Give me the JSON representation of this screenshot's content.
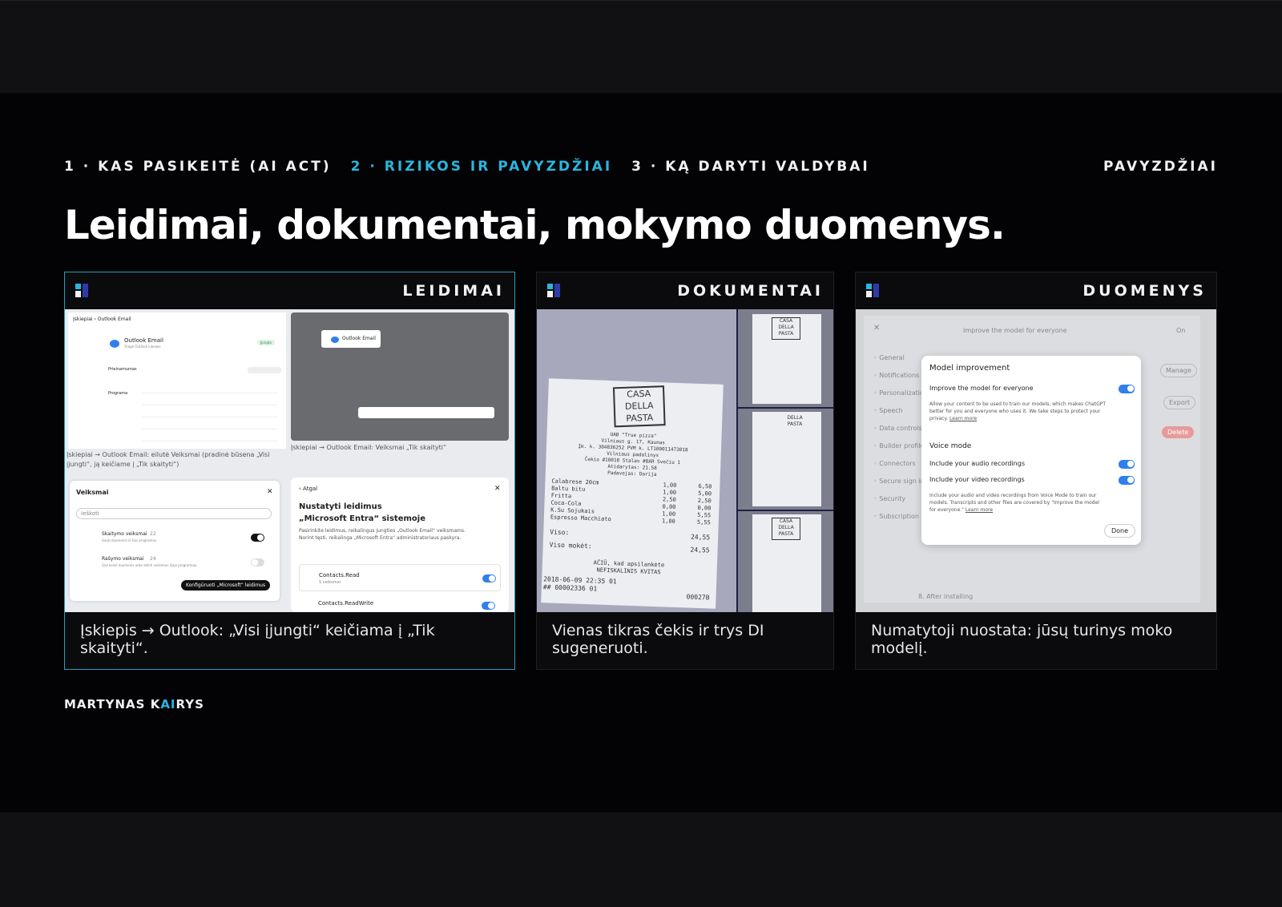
{
  "nav": {
    "items": [
      "1 · KAS PASIKEITĖ (AI ACT)",
      "2 · RIZIKOS IR PAVYZDŽIAI",
      "3 · KĄ DARYTI VALDYBAI"
    ],
    "right": "PAVYZDŽIAI"
  },
  "title": "Leidimai, dokumentai, mokymo duomenys.",
  "cards": [
    {
      "label": "LEIDIMAI",
      "caption": "Įskiepis → Outlook: „Visi įjungti“ keičiama į „Tik skaityti“.",
      "shot": {
        "breadcrumb": "Įskiepiai  ›  Outlook Email",
        "app_name": "Outlook Email",
        "app_sub": "Triage Outlook inboxes",
        "status": "Įjungta",
        "row1": "Prieinamumas",
        "row2": "Programa",
        "left_caption": "Įskiepiai → Outlook Email: eilutė Veiksmai (pradinė būsena „Visi įjungti“, ją keičiame į „Tik skaityti“)",
        "right_caption": "Įskiepiai → Outlook Email: Veiksmai „Tik skaityti“",
        "dialog_title": "Veiksmai",
        "search_placeholder": "Ieškoti",
        "read_actions": "Skaitymo veiksmai",
        "read_count": "22",
        "read_sub": "Gauti duomenis iš šios programos.",
        "write_actions": "Rašymo veiksmai",
        "write_count": "24",
        "write_sub": "Gali keisti duomenis arba atlikti veiksmus šioje programoje.",
        "configure_button": "Konfigūruoti „Microsoft“ leidimus",
        "back": "Atgal",
        "entra_title_1": "Nustatyti leidimus",
        "entra_title_2": "„Microsoft Entra“ sistemoje",
        "entra_desc": "Pasirinkite leidimus, reikalingus jungties „Outlook Email“ veiksmams. Norint tęsti, reikalinga „Microsoft Entra“ administratoriaus paskyra.",
        "perm1": "Contacts.Read",
        "perm1_sub": "5 veiksmai",
        "perm2": "Contacts.ReadWrite"
      }
    },
    {
      "label": "DOKUMENTAI",
      "caption": "Vienas tikras čekis ir trys DI sugeneruoti.",
      "shot": {
        "brand_1": "CASA",
        "brand_2": "DELLA",
        "brand_3": "PASTA",
        "lines": [
          "UAB \"True pizza\"",
          "Vilniaus g. 17, Kaunas",
          "Įm. k. 304836252  PVM k. LT100011473018",
          "Vilniaus padalinys",
          "Čekio #10018  Stalas #8AR  Svečiu 1",
          "Atidarytas: 21.58",
          "Padavejas: Darija"
        ],
        "items": [
          [
            "Calabrese 20cm",
            "1,00",
            "6,50"
          ],
          [
            "Baltu bitu",
            "1,00",
            "5,00"
          ],
          [
            "Fritta",
            "2,50",
            "2,50"
          ],
          [
            "Coca-Cola",
            "0,00",
            "0,00"
          ],
          [
            "K.Su Sojukais",
            "1,00",
            "5,55"
          ],
          [
            "Espresso Macchiato",
            "1,00",
            "5,55"
          ]
        ],
        "total_label_1": "Viso:",
        "total_1": "24,55",
        "total_label_2": "Viso mokėt:",
        "total_2": "24,55",
        "thanks": "AČIŪ, kad apsilankėte",
        "not_fiscal": "NEFISKALINIS KVITAS",
        "date": "2018-06-09 22:35   01",
        "code": "## 00002336 01",
        "num": "00027B"
      }
    },
    {
      "label": "DUOMENYS",
      "caption": "Numatytoji nuostata: jūsų turinys moko modelį.",
      "shot": {
        "bg_title": "Improve the model for everyone",
        "bg_on": "On",
        "sidebar": [
          "General",
          "Notifications",
          "Personalization",
          "Speech",
          "Data controls",
          "Builder profile",
          "Connectors",
          "Secure sign in",
          "Security",
          "Subscription"
        ],
        "manage": "Manage",
        "export": "Export",
        "delete": "Delete",
        "after": "8. After installing",
        "modal_title": "Model improvement",
        "improve_label": "Improve the model for everyone",
        "improve_desc": "Allow your content to be used to train our models, which makes ChatGPT better for you and everyone who uses it. We take steps to protect your privacy.",
        "learn_more": "Learn more",
        "voice_title": "Voice mode",
        "audio_label": "Include your audio recordings",
        "video_label": "Include your video recordings",
        "voice_desc": "Include your audio and video recordings from Voice Mode to train our models. Transcripts and other files are covered by \"Improve the model for everyone.\"",
        "done": "Done"
      }
    }
  ],
  "footer": {
    "name_1": "MARTYNAS K",
    "name_ai": "AI",
    "name_2": "RYS"
  }
}
